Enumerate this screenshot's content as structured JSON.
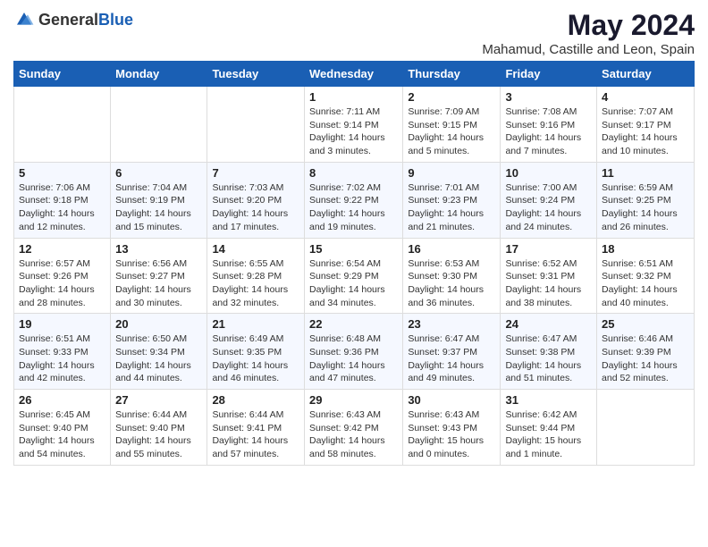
{
  "header": {
    "logo_general": "General",
    "logo_blue": "Blue",
    "month_year": "May 2024",
    "location": "Mahamud, Castille and Leon, Spain"
  },
  "weekdays": [
    "Sunday",
    "Monday",
    "Tuesday",
    "Wednesday",
    "Thursday",
    "Friday",
    "Saturday"
  ],
  "weeks": [
    [
      {
        "day": "",
        "sunrise": "",
        "sunset": "",
        "daylight": ""
      },
      {
        "day": "",
        "sunrise": "",
        "sunset": "",
        "daylight": ""
      },
      {
        "day": "",
        "sunrise": "",
        "sunset": "",
        "daylight": ""
      },
      {
        "day": "1",
        "sunrise": "Sunrise: 7:11 AM",
        "sunset": "Sunset: 9:14 PM",
        "daylight": "Daylight: 14 hours and 3 minutes."
      },
      {
        "day": "2",
        "sunrise": "Sunrise: 7:09 AM",
        "sunset": "Sunset: 9:15 PM",
        "daylight": "Daylight: 14 hours and 5 minutes."
      },
      {
        "day": "3",
        "sunrise": "Sunrise: 7:08 AM",
        "sunset": "Sunset: 9:16 PM",
        "daylight": "Daylight: 14 hours and 7 minutes."
      },
      {
        "day": "4",
        "sunrise": "Sunrise: 7:07 AM",
        "sunset": "Sunset: 9:17 PM",
        "daylight": "Daylight: 14 hours and 10 minutes."
      }
    ],
    [
      {
        "day": "5",
        "sunrise": "Sunrise: 7:06 AM",
        "sunset": "Sunset: 9:18 PM",
        "daylight": "Daylight: 14 hours and 12 minutes."
      },
      {
        "day": "6",
        "sunrise": "Sunrise: 7:04 AM",
        "sunset": "Sunset: 9:19 PM",
        "daylight": "Daylight: 14 hours and 15 minutes."
      },
      {
        "day": "7",
        "sunrise": "Sunrise: 7:03 AM",
        "sunset": "Sunset: 9:20 PM",
        "daylight": "Daylight: 14 hours and 17 minutes."
      },
      {
        "day": "8",
        "sunrise": "Sunrise: 7:02 AM",
        "sunset": "Sunset: 9:22 PM",
        "daylight": "Daylight: 14 hours and 19 minutes."
      },
      {
        "day": "9",
        "sunrise": "Sunrise: 7:01 AM",
        "sunset": "Sunset: 9:23 PM",
        "daylight": "Daylight: 14 hours and 21 minutes."
      },
      {
        "day": "10",
        "sunrise": "Sunrise: 7:00 AM",
        "sunset": "Sunset: 9:24 PM",
        "daylight": "Daylight: 14 hours and 24 minutes."
      },
      {
        "day": "11",
        "sunrise": "Sunrise: 6:59 AM",
        "sunset": "Sunset: 9:25 PM",
        "daylight": "Daylight: 14 hours and 26 minutes."
      }
    ],
    [
      {
        "day": "12",
        "sunrise": "Sunrise: 6:57 AM",
        "sunset": "Sunset: 9:26 PM",
        "daylight": "Daylight: 14 hours and 28 minutes."
      },
      {
        "day": "13",
        "sunrise": "Sunrise: 6:56 AM",
        "sunset": "Sunset: 9:27 PM",
        "daylight": "Daylight: 14 hours and 30 minutes."
      },
      {
        "day": "14",
        "sunrise": "Sunrise: 6:55 AM",
        "sunset": "Sunset: 9:28 PM",
        "daylight": "Daylight: 14 hours and 32 minutes."
      },
      {
        "day": "15",
        "sunrise": "Sunrise: 6:54 AM",
        "sunset": "Sunset: 9:29 PM",
        "daylight": "Daylight: 14 hours and 34 minutes."
      },
      {
        "day": "16",
        "sunrise": "Sunrise: 6:53 AM",
        "sunset": "Sunset: 9:30 PM",
        "daylight": "Daylight: 14 hours and 36 minutes."
      },
      {
        "day": "17",
        "sunrise": "Sunrise: 6:52 AM",
        "sunset": "Sunset: 9:31 PM",
        "daylight": "Daylight: 14 hours and 38 minutes."
      },
      {
        "day": "18",
        "sunrise": "Sunrise: 6:51 AM",
        "sunset": "Sunset: 9:32 PM",
        "daylight": "Daylight: 14 hours and 40 minutes."
      }
    ],
    [
      {
        "day": "19",
        "sunrise": "Sunrise: 6:51 AM",
        "sunset": "Sunset: 9:33 PM",
        "daylight": "Daylight: 14 hours and 42 minutes."
      },
      {
        "day": "20",
        "sunrise": "Sunrise: 6:50 AM",
        "sunset": "Sunset: 9:34 PM",
        "daylight": "Daylight: 14 hours and 44 minutes."
      },
      {
        "day": "21",
        "sunrise": "Sunrise: 6:49 AM",
        "sunset": "Sunset: 9:35 PM",
        "daylight": "Daylight: 14 hours and 46 minutes."
      },
      {
        "day": "22",
        "sunrise": "Sunrise: 6:48 AM",
        "sunset": "Sunset: 9:36 PM",
        "daylight": "Daylight: 14 hours and 47 minutes."
      },
      {
        "day": "23",
        "sunrise": "Sunrise: 6:47 AM",
        "sunset": "Sunset: 9:37 PM",
        "daylight": "Daylight: 14 hours and 49 minutes."
      },
      {
        "day": "24",
        "sunrise": "Sunrise: 6:47 AM",
        "sunset": "Sunset: 9:38 PM",
        "daylight": "Daylight: 14 hours and 51 minutes."
      },
      {
        "day": "25",
        "sunrise": "Sunrise: 6:46 AM",
        "sunset": "Sunset: 9:39 PM",
        "daylight": "Daylight: 14 hours and 52 minutes."
      }
    ],
    [
      {
        "day": "26",
        "sunrise": "Sunrise: 6:45 AM",
        "sunset": "Sunset: 9:40 PM",
        "daylight": "Daylight: 14 hours and 54 minutes."
      },
      {
        "day": "27",
        "sunrise": "Sunrise: 6:44 AM",
        "sunset": "Sunset: 9:40 PM",
        "daylight": "Daylight: 14 hours and 55 minutes."
      },
      {
        "day": "28",
        "sunrise": "Sunrise: 6:44 AM",
        "sunset": "Sunset: 9:41 PM",
        "daylight": "Daylight: 14 hours and 57 minutes."
      },
      {
        "day": "29",
        "sunrise": "Sunrise: 6:43 AM",
        "sunset": "Sunset: 9:42 PM",
        "daylight": "Daylight: 14 hours and 58 minutes."
      },
      {
        "day": "30",
        "sunrise": "Sunrise: 6:43 AM",
        "sunset": "Sunset: 9:43 PM",
        "daylight": "Daylight: 15 hours and 0 minutes."
      },
      {
        "day": "31",
        "sunrise": "Sunrise: 6:42 AM",
        "sunset": "Sunset: 9:44 PM",
        "daylight": "Daylight: 15 hours and 1 minute."
      },
      {
        "day": "",
        "sunrise": "",
        "sunset": "",
        "daylight": ""
      }
    ]
  ]
}
